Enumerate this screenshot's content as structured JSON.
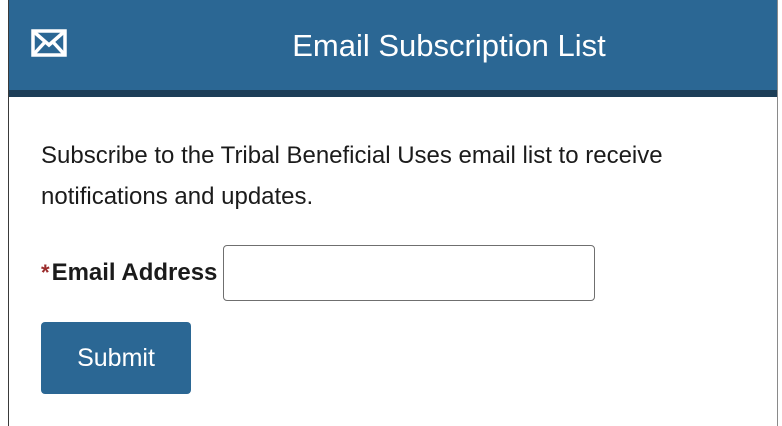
{
  "header": {
    "icon": "envelope-icon",
    "title": "Email Subscription List"
  },
  "intro_text": "Subscribe to the Tribal Beneficial Uses email list to receive notifications and updates.",
  "form": {
    "required_marker": "*",
    "email_label": "Email Address",
    "email_value": "",
    "email_placeholder": "",
    "submit_label": "Submit"
  },
  "colors": {
    "header_bg": "#2b6794",
    "header_border": "#1c3e58",
    "button_bg": "#2b6794",
    "required_star": "#9b2c2c"
  }
}
